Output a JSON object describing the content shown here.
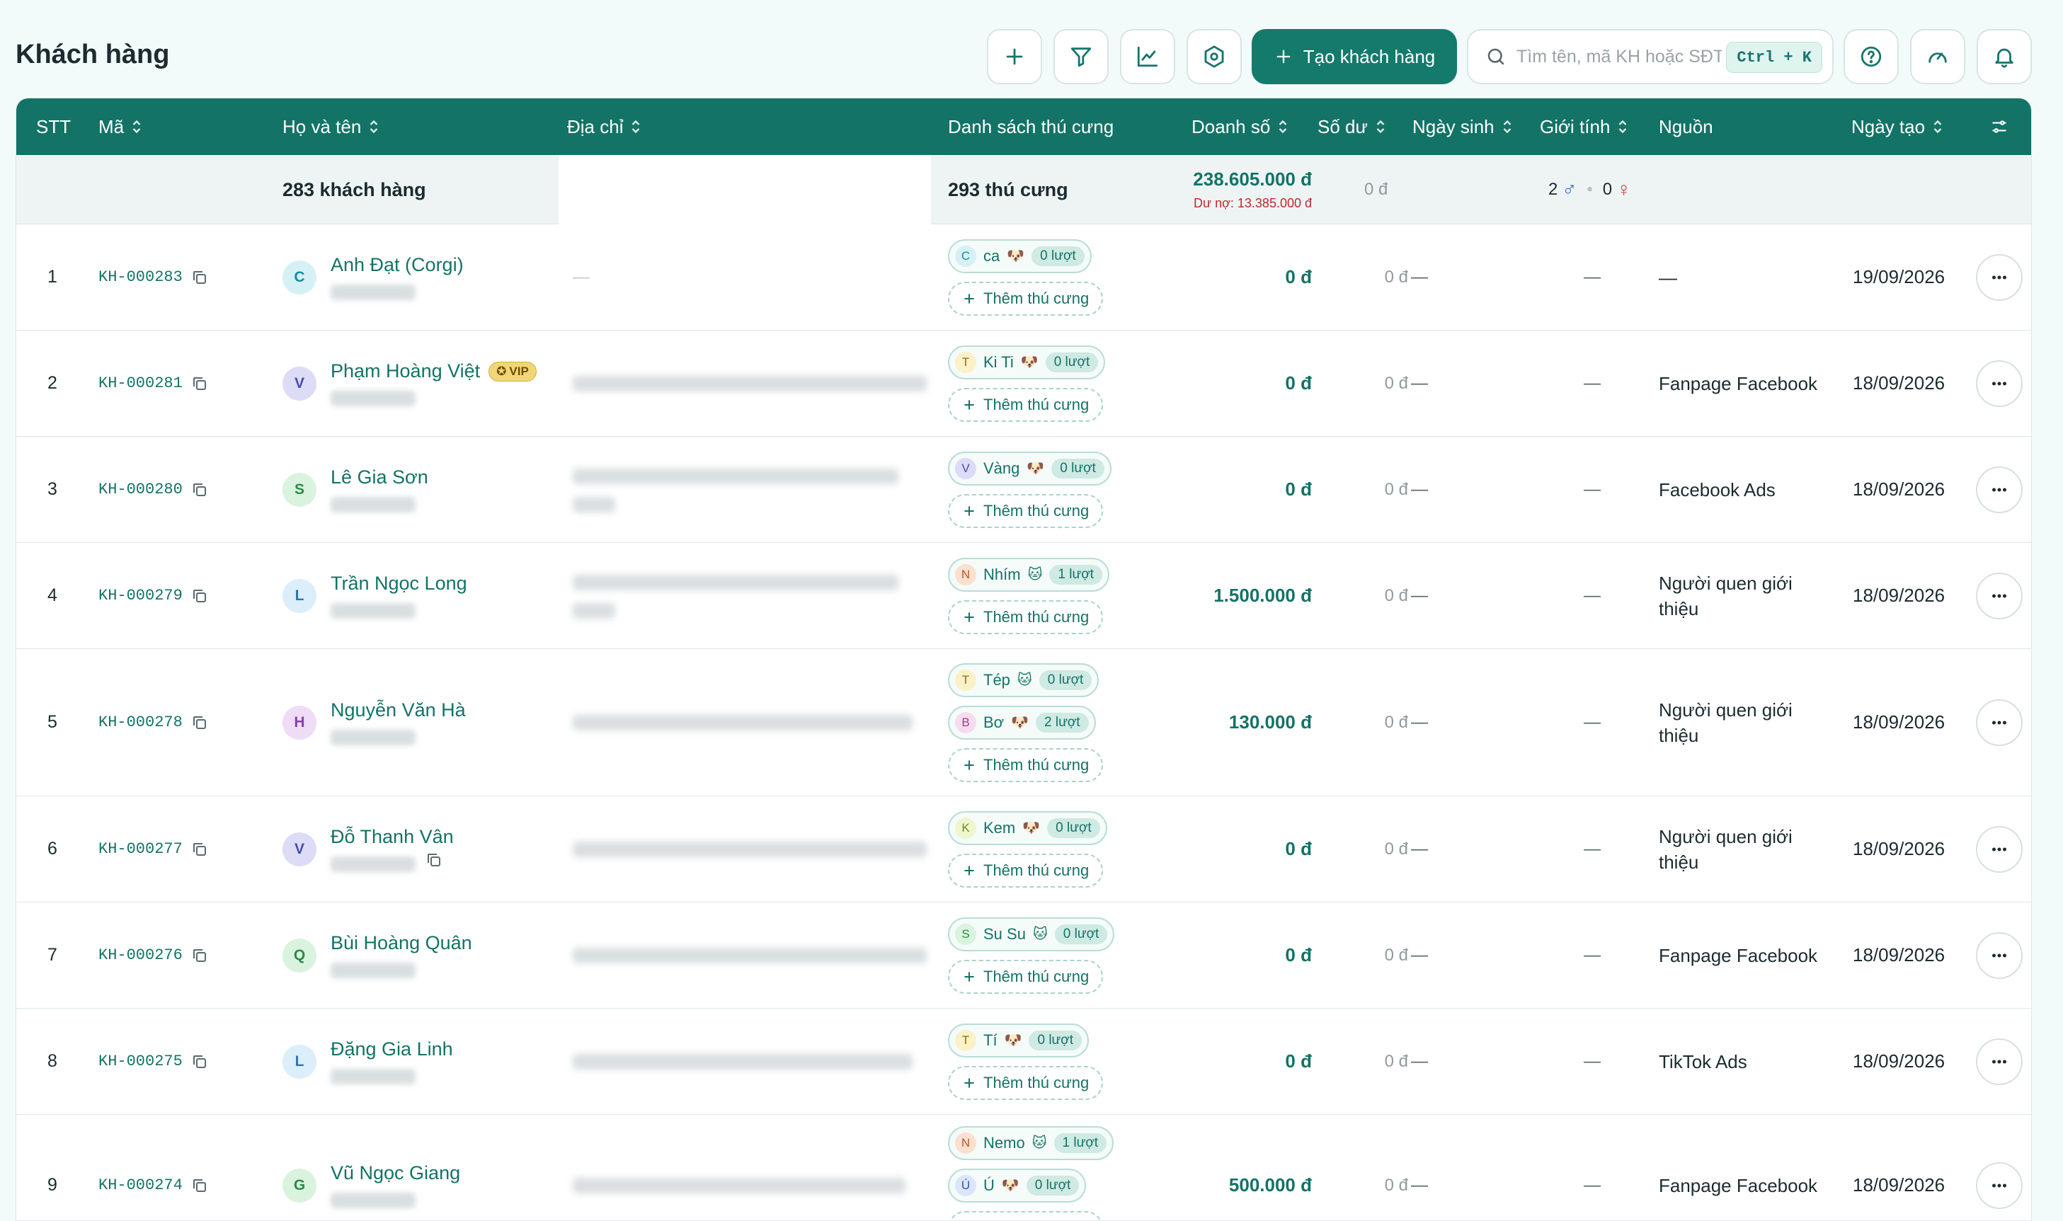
{
  "page": {
    "title": "Khách hàng"
  },
  "toolbar": {
    "create_label": "Tạo khách hàng",
    "search_placeholder": "Tìm tên, mã KH hoặc SĐT",
    "shortcut": "Ctrl + K",
    "icons": [
      "plus-icon",
      "filter-icon",
      "chart-icon",
      "settings-icon",
      "help-icon",
      "gauge-icon",
      "bell-icon"
    ]
  },
  "columns": {
    "stt": "STT",
    "code": "Mã",
    "name": "Họ và tên",
    "address": "Địa chỉ",
    "pets": "Danh sách thú cưng",
    "revenue": "Doanh số",
    "balance": "Số dư",
    "birthday": "Ngày sinh",
    "gender": "Giới tính",
    "source": "Nguồn",
    "created": "Ngày tạo"
  },
  "summary": {
    "customers": "283 khách hàng",
    "pets": "293 thú cưng",
    "revenue": "238.605.000 đ",
    "debt": "Dư nợ: 13.385.000 đ",
    "balance": "0 đ",
    "male_count": "2",
    "female_count": "0",
    "male_symbol": "♂",
    "female_symbol": "♀"
  },
  "pet_add_label": "Thêm thú cưng",
  "dash": "—",
  "vip_label": "VIP",
  "rows": [
    {
      "stt": "1",
      "code": "KH-000283",
      "initial": "C",
      "name": "Anh Đạt (Corgi)",
      "address_dash": "—",
      "pets": [
        {
          "initial": "C",
          "name": "ca",
          "emoji": "🐶",
          "visits": "0 lượt"
        }
      ],
      "revenue": "0 đ",
      "balance": "0 đ",
      "birthday": "—",
      "gender": "—",
      "source": "—",
      "created": "19/09/2026"
    },
    {
      "stt": "2",
      "code": "KH-000281",
      "initial": "V",
      "name": "Phạm Hoàng Việt",
      "vip": true,
      "pets": [
        {
          "initial": "T",
          "name": "Ki Ti",
          "emoji": "🐶",
          "visits": "0 lượt"
        }
      ],
      "revenue": "0 đ",
      "balance": "0 đ",
      "birthday": "—",
      "gender": "—",
      "source": "Fanpage Facebook",
      "created": "18/09/2026"
    },
    {
      "stt": "3",
      "code": "KH-000280",
      "initial": "S",
      "name": "Lê Gia Sơn",
      "pets": [
        {
          "initial": "V",
          "name": "Vàng",
          "emoji": "🐶",
          "visits": "0 lượt"
        }
      ],
      "revenue": "0 đ",
      "balance": "0 đ",
      "birthday": "—",
      "gender": "—",
      "source": "Facebook Ads",
      "created": "18/09/2026"
    },
    {
      "stt": "4",
      "code": "KH-000279",
      "initial": "L",
      "name": "Trần Ngọc Long",
      "pets": [
        {
          "initial": "N",
          "name": "Nhím",
          "emoji": "🐱",
          "visits": "1 lượt"
        }
      ],
      "revenue": "1.500.000 đ",
      "balance": "0 đ",
      "birthday": "—",
      "gender": "—",
      "source": "Người quen giới thiệu",
      "created": "18/09/2026"
    },
    {
      "stt": "5",
      "code": "KH-000278",
      "initial": "H",
      "name": "Nguyễn Văn Hà",
      "pets": [
        {
          "initial": "T",
          "name": "Tép",
          "emoji": "🐱",
          "visits": "0 lượt"
        },
        {
          "initial": "B",
          "name": "Bơ",
          "emoji": "🐶",
          "visits": "2 lượt"
        }
      ],
      "revenue": "130.000 đ",
      "balance": "0 đ",
      "birthday": "—",
      "gender": "—",
      "source": "Người quen giới thiệu",
      "created": "18/09/2026"
    },
    {
      "stt": "6",
      "code": "KH-000277",
      "initial": "V",
      "name": "Đỗ Thanh Vân",
      "pets": [
        {
          "initial": "K",
          "name": "Kem",
          "emoji": "🐶",
          "visits": "0 lượt"
        }
      ],
      "revenue": "0 đ",
      "balance": "0 đ",
      "birthday": "—",
      "gender": "—",
      "source": "Người quen giới thiệu",
      "created": "18/09/2026"
    },
    {
      "stt": "7",
      "code": "KH-000276",
      "initial": "Q",
      "name": "Bùi Hoàng Quân",
      "pets": [
        {
          "initial": "S",
          "name": "Su Su",
          "emoji": "🐱",
          "visits": "0 lượt"
        }
      ],
      "revenue": "0 đ",
      "balance": "0 đ",
      "birthday": "—",
      "gender": "—",
      "source": "Fanpage Facebook",
      "created": "18/09/2026"
    },
    {
      "stt": "8",
      "code": "KH-000275",
      "initial": "L",
      "name": "Đặng Gia Linh",
      "pets": [
        {
          "initial": "T",
          "name": "Tí",
          "emoji": "🐶",
          "visits": "0 lượt"
        }
      ],
      "revenue": "0 đ",
      "balance": "0 đ",
      "birthday": "—",
      "gender": "—",
      "source": "TikTok Ads",
      "created": "18/09/2026"
    },
    {
      "stt": "9",
      "code": "KH-000274",
      "initial": "G",
      "name": "Vũ Ngọc Giang",
      "pets": [
        {
          "initial": "N",
          "name": "Nemo",
          "emoji": "🐱",
          "visits": "1 lượt"
        },
        {
          "initial": "Ú",
          "name": "Ú",
          "emoji": "🐶",
          "visits": "0 lượt"
        }
      ],
      "revenue": "500.000 đ",
      "balance": "0 đ",
      "birthday": "—",
      "gender": "—",
      "source": "Fanpage Facebook",
      "created": "18/09/2026"
    }
  ],
  "colors": {
    "primary": "#137366",
    "header_bg": "#137366",
    "debt": "#c0282d",
    "male": "#2d6bd6",
    "female": "#d6303a",
    "vip": "#f1d679"
  }
}
